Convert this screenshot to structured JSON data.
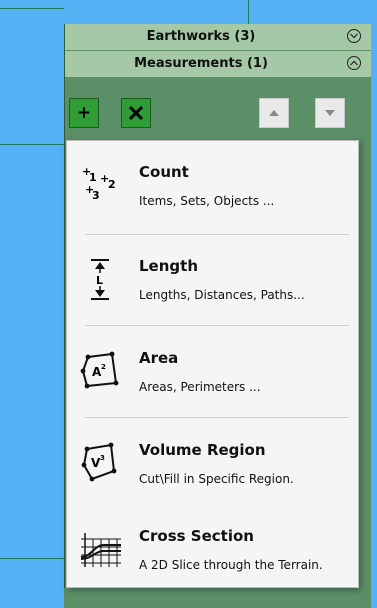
{
  "panel": {
    "sections": [
      {
        "title": "Earthworks (3)",
        "state": "collapsed"
      },
      {
        "title": "Measurements (1)",
        "state": "expanded"
      }
    ],
    "toolbar": {
      "add_label": "+",
      "delete_icon": "close-x-icon",
      "up_icon": "arrow-up-icon",
      "down_icon": "arrow-down-icon"
    }
  },
  "menu": {
    "items": [
      {
        "label": "Count",
        "description": "Items, Sets, Objects ...",
        "icon": "count-icon"
      },
      {
        "label": "Length",
        "description": "Lengths, Distances, Paths...",
        "icon": "length-icon"
      },
      {
        "label": "Area",
        "description": "Areas, Perimeters ...",
        "icon": "area-icon"
      },
      {
        "label": "Volume Region",
        "description": "Cut\\Fill in Specific Region.",
        "icon": "volume-icon"
      },
      {
        "label": "Cross Section",
        "description": "A 2D Slice through the Terrain.",
        "icon": "cross-section-icon"
      }
    ]
  },
  "icon_text": {
    "count": {
      "a": "1",
      "b": "2",
      "c": "3"
    },
    "length": "L",
    "area": "A",
    "area_exp": "2",
    "volume": "V",
    "volume_exp": "3"
  },
  "colors": {
    "background": "#54b1f4",
    "panel": "#5b8f68",
    "header": "#a5c8a7",
    "add_button": "#2f9c35",
    "menu_bg": "#f5f5f5"
  }
}
